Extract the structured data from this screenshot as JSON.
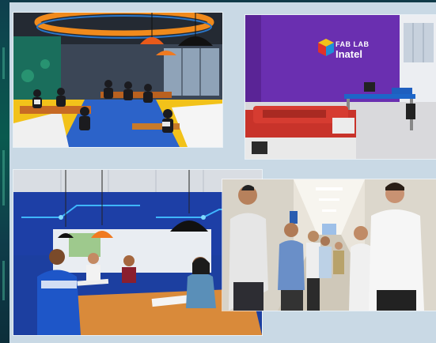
{
  "collage": {
    "photos": [
      {
        "name": "coworking-space-photo"
      },
      {
        "name": "fab-lab-photo"
      },
      {
        "name": "blue-workspace-photo"
      },
      {
        "name": "group-hallway-photo"
      }
    ]
  },
  "fablab_sign": {
    "line1": "FAB LAB",
    "line2": "Inatel"
  }
}
